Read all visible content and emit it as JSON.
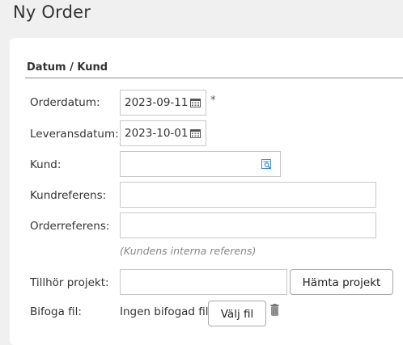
{
  "page": {
    "title": "Ny Order"
  },
  "section": {
    "title": "Datum / Kund"
  },
  "form": {
    "orderdatum": {
      "label": "Orderdatum:",
      "value": "2023-09-11",
      "required_mark": "*"
    },
    "leveransdatum": {
      "label": "Leveransdatum:",
      "value": "2023-10-01"
    },
    "kund": {
      "label": "Kund:",
      "value": ""
    },
    "kundreferens": {
      "label": "Kundreferens:",
      "value": ""
    },
    "orderreferens": {
      "label": "Orderreferens:",
      "value": "",
      "hint": "(Kundens interna referens)"
    },
    "projekt": {
      "label": "Tillhör projekt:",
      "value": "",
      "button": "Hämta projekt"
    },
    "bifoga": {
      "label": "Bifoga fil:",
      "status": "Ingen bifogad fil",
      "button": "Välj fil"
    }
  },
  "icons": {
    "calendar": "calendar-icon",
    "lookup": "customer-lookup-icon",
    "trash": "trash-icon"
  },
  "colors": {
    "background": "#f0f0f0",
    "panel": "#ffffff",
    "lookup_icon": "#3a86c8"
  }
}
